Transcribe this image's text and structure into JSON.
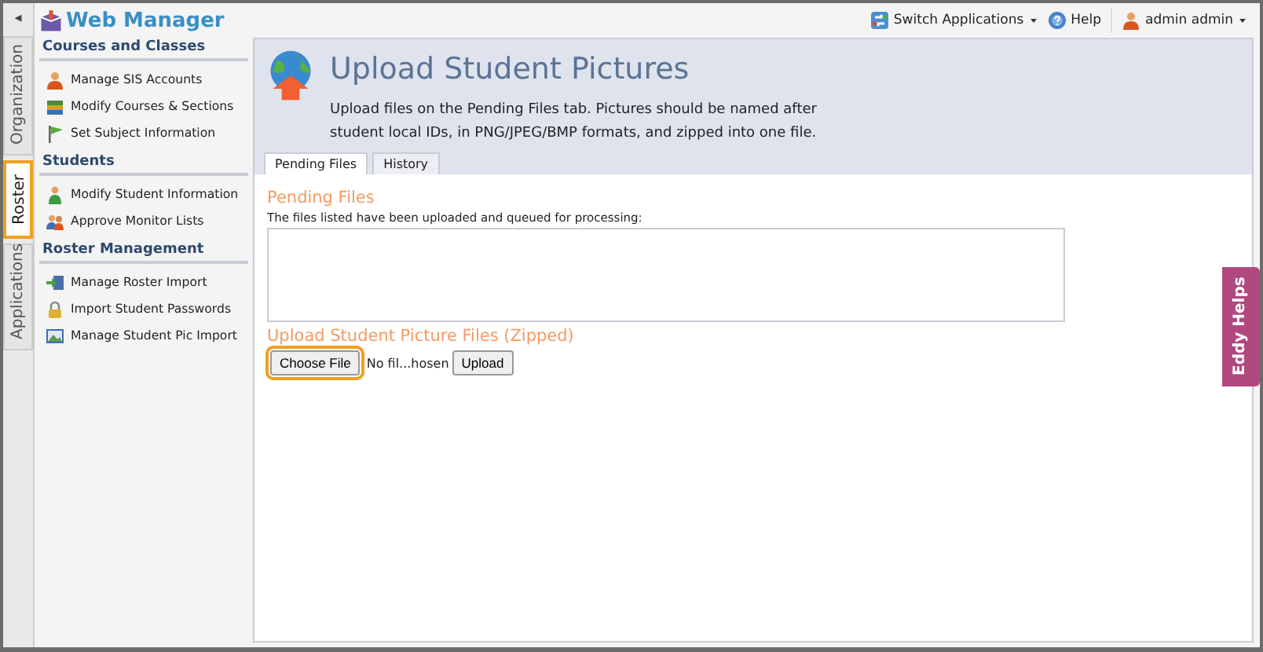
{
  "app": {
    "title": "Web Manager",
    "collapse_glyph": "◂"
  },
  "side_tabs": [
    {
      "label": "Organization",
      "selected": false
    },
    {
      "label": "Roster",
      "selected": true
    },
    {
      "label": "Applications",
      "selected": false
    }
  ],
  "top_bar": [
    {
      "label": "Switch Applications",
      "kind": "switch",
      "dropdown": true
    },
    {
      "label": "Help",
      "kind": "help",
      "dropdown": false
    },
    {
      "label": "admin admin",
      "kind": "user",
      "dropdown": true
    }
  ],
  "sidebar": [
    {
      "title": "Courses and Classes",
      "items": [
        {
          "label": "Manage SIS Accounts",
          "kind": "person"
        },
        {
          "label": "Modify Courses & Sections",
          "kind": "books"
        },
        {
          "label": "Set Subject Information",
          "kind": "flag"
        }
      ]
    },
    {
      "title": "Students",
      "items": [
        {
          "label": "Modify Student Information",
          "kind": "student"
        },
        {
          "label": "Approve Monitor Lists",
          "kind": "group"
        }
      ]
    },
    {
      "title": "Roster Management",
      "items": [
        {
          "label": "Manage Roster Import",
          "kind": "import"
        },
        {
          "label": "Import Student Passwords",
          "kind": "lock"
        },
        {
          "label": "Manage Student Pic Import",
          "kind": "photo"
        }
      ]
    }
  ],
  "page": {
    "title": "Upload Student Pictures",
    "description": "Upload files on the Pending Files tab. Pictures should be named after student local IDs, in PNG/JPEG/BMP formats, and zipped into one file."
  },
  "tabs": [
    {
      "label": "Pending Files",
      "selected": true
    },
    {
      "label": "History",
      "selected": false
    }
  ],
  "pending": {
    "heading": "Pending Files",
    "note": "The files listed have been uploaded and queued for processing:"
  },
  "upload": {
    "heading": "Upload Student Picture Files (Zipped)",
    "choose_button": "Choose File",
    "focused": true,
    "file_status": "No fil...hosen",
    "upload_button": "Upload"
  },
  "help_tab": {
    "label": "Eddy Helps"
  }
}
